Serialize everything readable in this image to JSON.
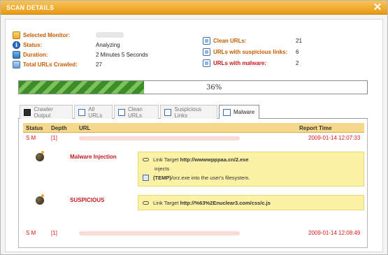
{
  "window": {
    "title": "SCAN DETAILS",
    "close_glyph": "✕"
  },
  "summary": {
    "selected_monitor_label": "Selected Monitor:",
    "status_label": "Status:",
    "status_value": "Analyzing",
    "duration_label": "Duration:",
    "duration_value": "2 Minutes 5 Seconds",
    "total_urls_label": "Total URLs Crawled:",
    "total_urls_value": "27",
    "clean_label": "Clean URLs:",
    "clean_value": "21",
    "suspicious_label": "URLs with suspicious links:",
    "suspicious_value": "6",
    "malware_label": "URLs with malware:",
    "malware_value": "2"
  },
  "progress": {
    "percent": 36,
    "text": "36%"
  },
  "tabs": [
    {
      "label": "Crawler Output",
      "icon": "console-icon"
    },
    {
      "label": "All URLs",
      "icon": "all-urls-icon"
    },
    {
      "label": "Clean URLs",
      "icon": "clean-urls-icon"
    },
    {
      "label": "Suspicious Links",
      "icon": "suspicious-links-icon"
    },
    {
      "label": "Malware",
      "icon": "malware-icon",
      "active": true
    }
  ],
  "table": {
    "headers": {
      "status": "Status",
      "depth": "Depth",
      "url": "URL",
      "report_time": "Report Time"
    },
    "rows": [
      {
        "status": "S M",
        "depth": "[1]",
        "report_time": "2009-01-14 12:07:33"
      },
      {
        "status": "S M",
        "depth": "[1]",
        "report_time": "2009-01-14 12:08:49"
      }
    ]
  },
  "threats": [
    {
      "title": "Malware Injection",
      "line1_prefix": "Link Target ",
      "line1_link": "http://wwwwpppaa.cn/2.exe",
      "line2": "injects",
      "line3_bold": "(TEMP)",
      "line3_rest": "/orz.exe into the user's filesystem."
    },
    {
      "title": "SUSPICIOUS",
      "line1_prefix": "Link Target ",
      "line1_link": "http://%63%2Enuclear3.com/css/c.js"
    }
  ],
  "colors": {
    "accent_orange": "#e79a14",
    "label_orange": "#c85a00",
    "danger_red": "#c81818",
    "progress_green": "#3c8d2a",
    "threat_bg": "#fbf2a6"
  }
}
